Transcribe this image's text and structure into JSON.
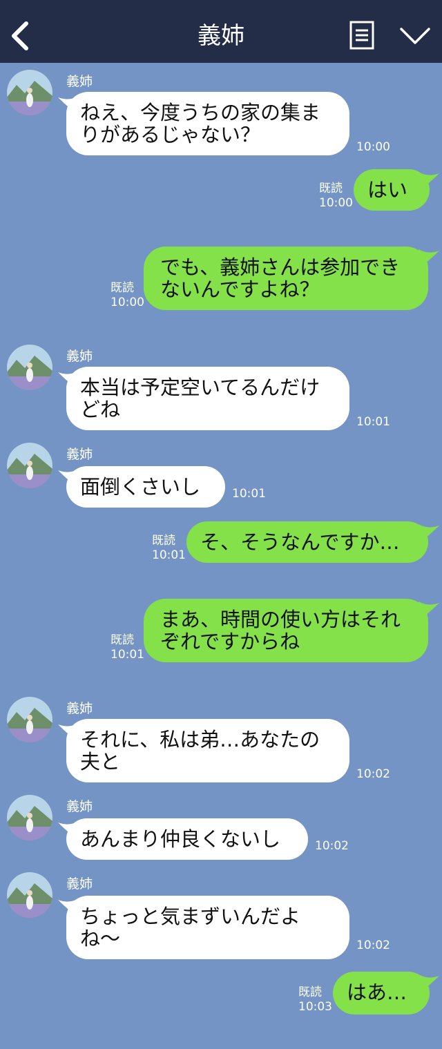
{
  "header": {
    "title": "義姉"
  },
  "colors": {
    "header_bg": "#242d48",
    "chat_bg": "#7394c4",
    "incoming_bubble": "#ffffff",
    "outgoing_bubble": "#84e14a"
  },
  "messages": [
    {
      "from": "other",
      "sender": "義姉",
      "text": "ねえ、今度うちの家の集まりがあるじゃない？",
      "time": "10:00"
    },
    {
      "from": "me",
      "text": "はい",
      "read": "既読",
      "time": "10:00"
    },
    {
      "from": "me",
      "text": "でも、義姉さんは参加できないんですよね？",
      "read": "既読",
      "time": "10:00"
    },
    {
      "from": "other",
      "sender": "義姉",
      "text": "本当は予定空いてるんだけどね",
      "time": "10:01"
    },
    {
      "from": "other",
      "sender": "義姉",
      "text": "面倒くさいし",
      "time": "10:01"
    },
    {
      "from": "me",
      "text": "そ、そうなんですか…",
      "read": "既読",
      "time": "10:01"
    },
    {
      "from": "me",
      "text": "まあ、時間の使い方はそれぞれですからね",
      "read": "既読",
      "time": "10:01"
    },
    {
      "from": "other",
      "sender": "義姉",
      "text": "それに、私は弟…あなたの夫と",
      "time": "10:02"
    },
    {
      "from": "other",
      "sender": "義姉",
      "text": "あんまり仲良くないし",
      "time": "10:02"
    },
    {
      "from": "other",
      "sender": "義姉",
      "text": "ちょっと気まずいんだよね〜",
      "time": "10:02"
    },
    {
      "from": "me",
      "text": "はあ…",
      "read": "既読",
      "time": "10:03"
    }
  ]
}
